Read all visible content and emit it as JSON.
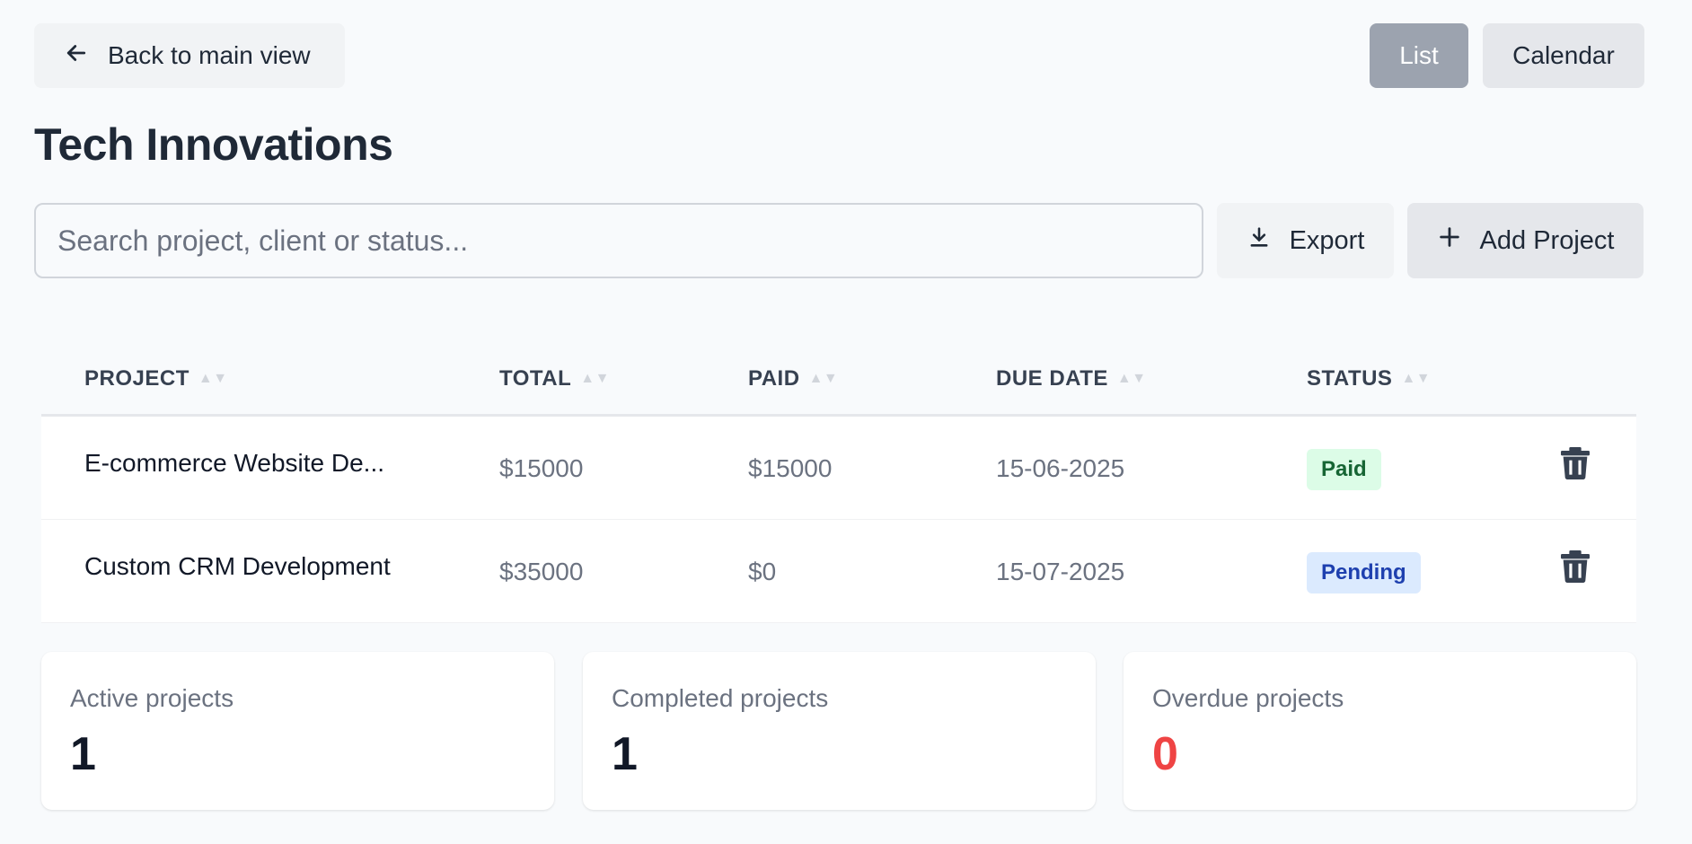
{
  "header": {
    "back_label": "Back to main view",
    "view_list": "List",
    "view_calendar": "Calendar",
    "title": "Tech Innovations"
  },
  "toolbar": {
    "search_placeholder": "Search project, client or status...",
    "export_label": "Export",
    "add_label": "Add Project"
  },
  "table": {
    "columns": [
      "PROJECT",
      "TOTAL",
      "PAID",
      "DUE DATE",
      "STATUS"
    ],
    "rows": [
      {
        "project": "E-commerce Website De...",
        "total": "$15000",
        "paid": "$15000",
        "due": "15-06-2025",
        "status": "Paid"
      },
      {
        "project": "Custom CRM Development",
        "total": "$35000",
        "paid": "$0",
        "due": "15-07-2025",
        "status": "Pending"
      }
    ]
  },
  "stats": [
    {
      "label": "Active projects",
      "value": "1"
    },
    {
      "label": "Completed projects",
      "value": "1"
    },
    {
      "label": "Overdue projects",
      "value": "0"
    }
  ],
  "colors": {
    "paid_badge_bg": "#dcfce7",
    "pending_badge_bg": "#dbeafe",
    "overdue_value": "#ef4444",
    "list_active_bg": "#9ca3af"
  }
}
